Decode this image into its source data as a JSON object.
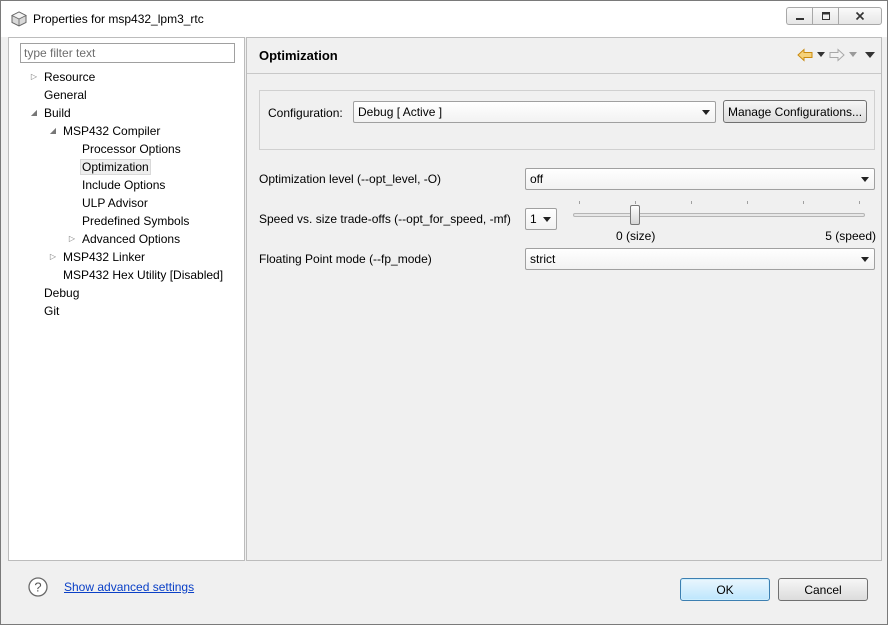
{
  "window": {
    "title": "Properties for msp432_lpm3_rtc",
    "controls": [
      "minimize-icon",
      "maximize-icon",
      "close-icon"
    ]
  },
  "filter": {
    "placeholder": "type filter text",
    "value": ""
  },
  "tree": {
    "resource": "Resource",
    "general": "General",
    "build": "Build",
    "compiler": "MSP432 Compiler",
    "processor_options": "Processor Options",
    "optimization": "Optimization",
    "include_options": "Include Options",
    "ulp_advisor": "ULP Advisor",
    "predefined_symbols": "Predefined Symbols",
    "advanced_options": "Advanced Options",
    "linker": "MSP432 Linker",
    "hex_utility": "MSP432 Hex Utility  [Disabled]",
    "debug": "Debug",
    "git": "Git",
    "selected": "Optimization"
  },
  "page": {
    "title": "Optimization",
    "configuration_label": "Configuration:",
    "configuration_value": "Debug  [ Active ]",
    "manage_button": "Manage Configurations...",
    "opt_level_label": "Optimization level (--opt_level, -O)",
    "opt_level_value": "off",
    "speed_label": "Speed vs. size trade-offs (--opt_for_speed, -mf)",
    "speed_value": "1",
    "speed_slider": {
      "value": 1,
      "min": 0,
      "max": 5,
      "min_label": "0 (size)",
      "max_label": "5 (speed)"
    },
    "fp_label": "Floating Point mode (--fp_mode)",
    "fp_value": "strict"
  },
  "footer": {
    "advanced_link": "Show advanced settings",
    "ok": "OK",
    "cancel": "Cancel"
  },
  "colors": {
    "link": "#0a40c7",
    "ok_border": "#3c7fb1",
    "back_arrow": "#e8a317"
  }
}
